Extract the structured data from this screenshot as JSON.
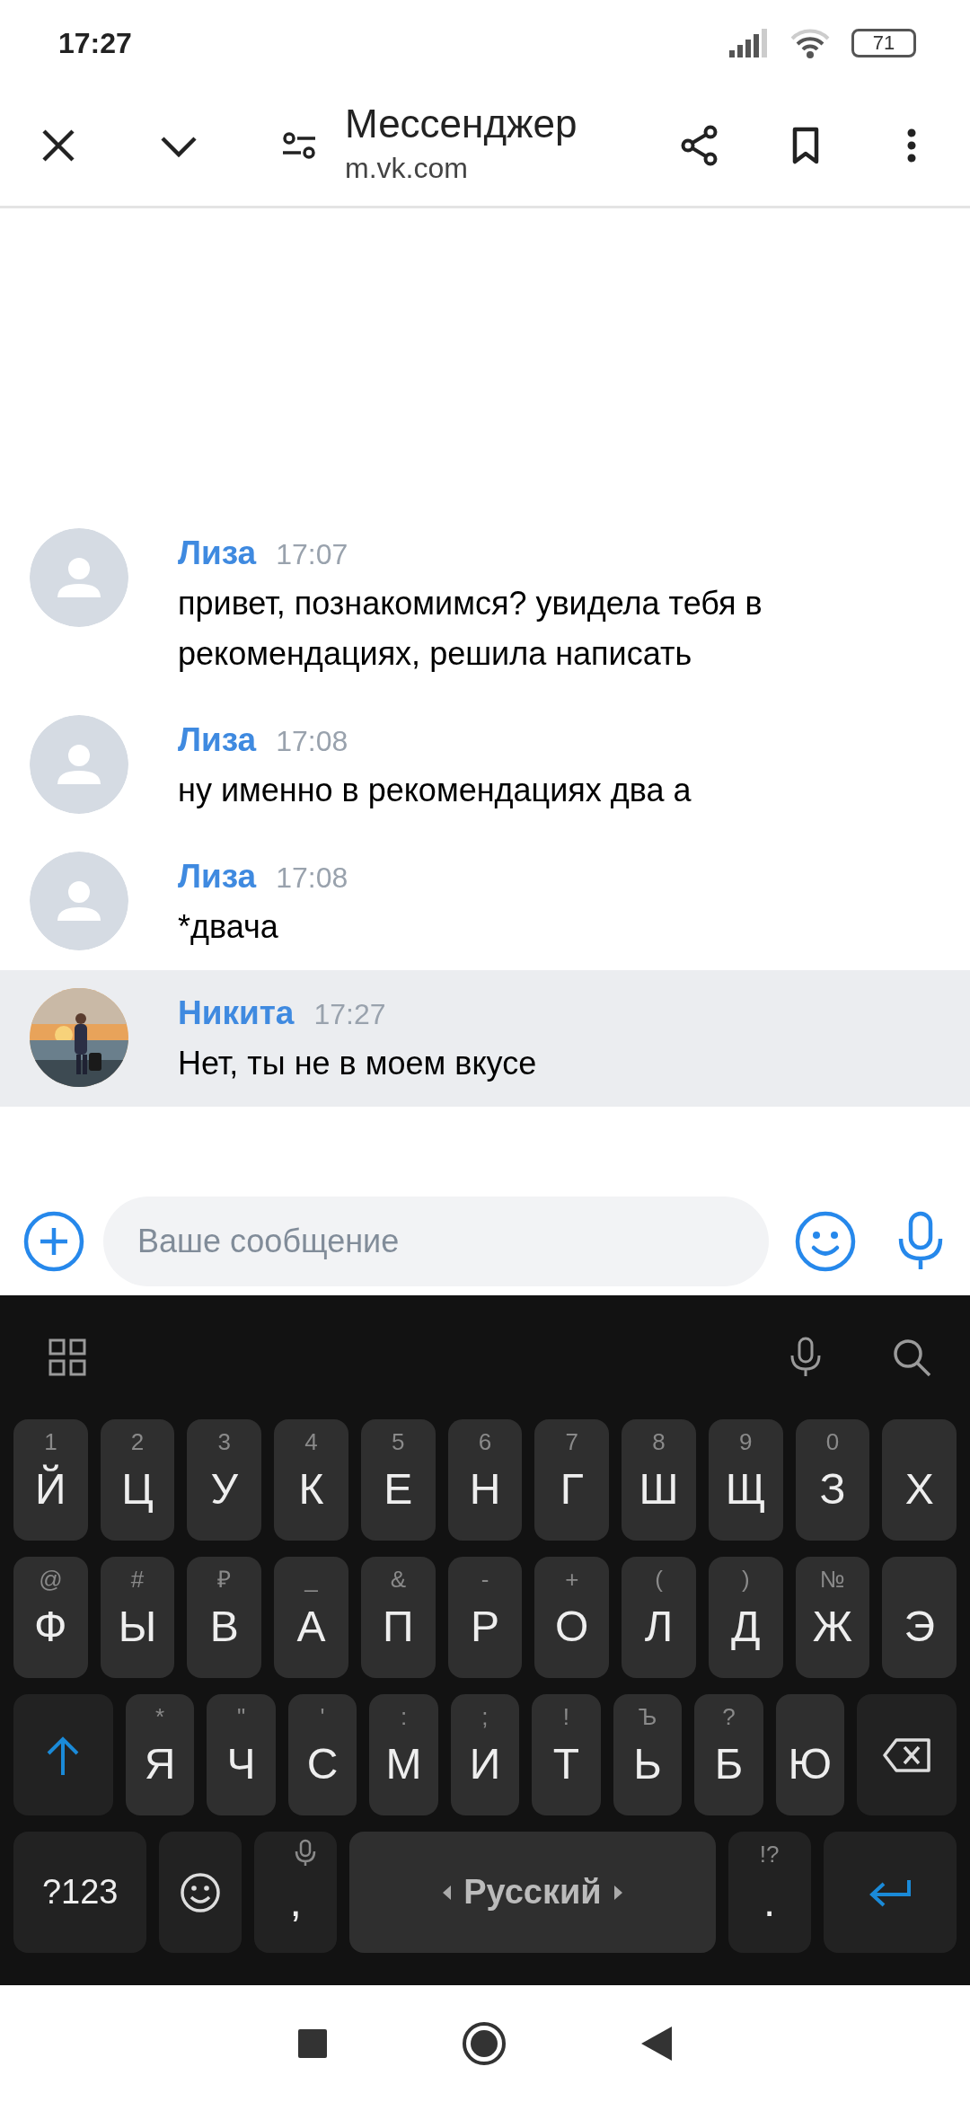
{
  "status_bar": {
    "time": "17:27",
    "battery": "71"
  },
  "toolbar": {
    "title": "Мессенджер",
    "url": "m.vk.com"
  },
  "messages": [
    {
      "author": "Лиза",
      "time": "17:07",
      "text": "привет, познакомимся? увидела тебя в рекомендациях, решила написать",
      "highlighted": false,
      "has_photo": false
    },
    {
      "author": "Лиза",
      "time": "17:08",
      "text": "ну именно в рекомендациях два а",
      "highlighted": false,
      "has_photo": false
    },
    {
      "author": "Лиза",
      "time": "17:08",
      "text": "*двача",
      "highlighted": false,
      "has_photo": false
    },
    {
      "author": "Никита",
      "time": "17:27",
      "text": "Нет, ты не в моем вкусе",
      "highlighted": true,
      "has_photo": true
    }
  ],
  "composer": {
    "placeholder": "Ваше сообщение"
  },
  "keyboard": {
    "rows": [
      {
        "keys": [
          {
            "kind": "letter",
            "label": "Й",
            "hint": "1"
          },
          {
            "kind": "letter",
            "label": "Ц",
            "hint": "2"
          },
          {
            "kind": "letter",
            "label": "У",
            "hint": "3"
          },
          {
            "kind": "letter",
            "label": "К",
            "hint": "4"
          },
          {
            "kind": "letter",
            "label": "Е",
            "hint": "5"
          },
          {
            "kind": "letter",
            "label": "Н",
            "hint": "6"
          },
          {
            "kind": "letter",
            "label": "Г",
            "hint": "7"
          },
          {
            "kind": "letter",
            "label": "Ш",
            "hint": "8"
          },
          {
            "kind": "letter",
            "label": "Щ",
            "hint": "9"
          },
          {
            "kind": "letter",
            "label": "З",
            "hint": "0"
          },
          {
            "kind": "letter",
            "label": "Х"
          }
        ]
      },
      {
        "keys": [
          {
            "kind": "letter",
            "label": "Ф",
            "hint": "@"
          },
          {
            "kind": "letter",
            "label": "Ы",
            "hint": "#"
          },
          {
            "kind": "letter",
            "label": "В",
            "hint": "₽"
          },
          {
            "kind": "letter",
            "label": "А",
            "hint": "_"
          },
          {
            "kind": "letter",
            "label": "П",
            "hint": "&"
          },
          {
            "kind": "letter",
            "label": "Р",
            "hint": "-"
          },
          {
            "kind": "letter",
            "label": "О",
            "hint": "+"
          },
          {
            "kind": "letter",
            "label": "Л",
            "hint": "("
          },
          {
            "kind": "letter",
            "label": "Д",
            "hint": ")"
          },
          {
            "kind": "letter",
            "label": "Ж",
            "hint": "№"
          },
          {
            "kind": "letter",
            "label": "Э"
          }
        ]
      },
      {
        "keys": [
          {
            "kind": "shift"
          },
          {
            "kind": "letter",
            "label": "Я",
            "hint": "*"
          },
          {
            "kind": "letter",
            "label": "Ч",
            "hint": "\""
          },
          {
            "kind": "letter",
            "label": "С",
            "hint": "'"
          },
          {
            "kind": "letter",
            "label": "М",
            "hint": ":"
          },
          {
            "kind": "letter",
            "label": "И",
            "hint": ";"
          },
          {
            "kind": "letter",
            "label": "Т",
            "hint": "!"
          },
          {
            "kind": "letter",
            "label": "Ь",
            "hint": "Ъ"
          },
          {
            "kind": "letter",
            "label": "Б",
            "hint": "?"
          },
          {
            "kind": "letter",
            "label": "Ю"
          },
          {
            "kind": "backspace"
          }
        ]
      },
      {
        "keys": [
          {
            "kind": "symbols",
            "label": "?123"
          },
          {
            "kind": "emoji"
          },
          {
            "kind": "comma",
            "label": ","
          },
          {
            "kind": "space",
            "label": "Русский"
          },
          {
            "kind": "period",
            "label": ".",
            "hint": "!?"
          },
          {
            "kind": "enter"
          }
        ]
      }
    ]
  }
}
